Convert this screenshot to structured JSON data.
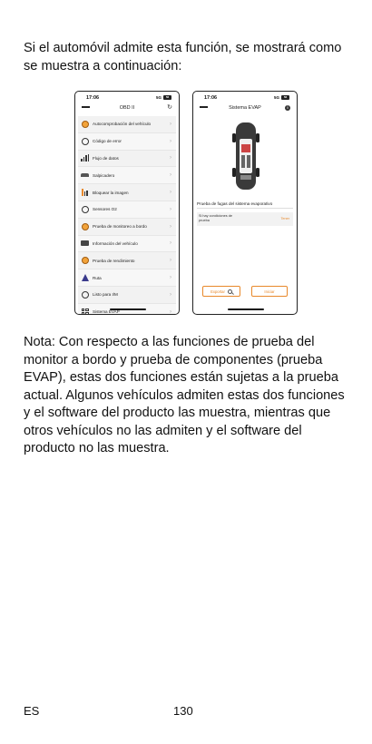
{
  "intro": "Si el automóvil admite esta función, se mostrará como se muestra a continuación:",
  "phone1": {
    "time": "17:06",
    "network": "5G",
    "battery": "56",
    "title": "OBD II",
    "menu": [
      {
        "label": "Autocomprobación del vehículo",
        "icon": "self-check-icon"
      },
      {
        "label": "Código de error",
        "icon": "error-code-icon"
      },
      {
        "label": "Flujo de datos",
        "icon": "data-stream-icon"
      },
      {
        "label": "Salpicadero",
        "icon": "dashboard-icon"
      },
      {
        "label": "Bloquear la imagen",
        "icon": "freeze-frame-icon"
      },
      {
        "label": "Sensores O2",
        "icon": "o2-sensor-icon"
      },
      {
        "label": "Prueba de monitoreo a bordo",
        "icon": "onboard-monitor-icon"
      },
      {
        "label": "Información del vehículo",
        "icon": "vehicle-info-icon"
      },
      {
        "label": "Prueba de rendimiento",
        "icon": "performance-icon"
      },
      {
        "label": "Ruta",
        "icon": "route-icon"
      },
      {
        "label": "Listo para I/M",
        "icon": "im-readiness-icon"
      },
      {
        "label": "Sistema EVAP",
        "icon": "evap-icon"
      }
    ]
  },
  "phone2": {
    "time": "17:06",
    "network": "5G",
    "battery": "56",
    "title": "Sistema EVAP",
    "section_title": "Prueba de fugas del sistema evaporativo",
    "row_label": "Si hay condiciones de prueba",
    "row_value": "Tener",
    "export_label": "Exportar",
    "start_label": "Iniciar"
  },
  "note": "Nota: Con respecto a las funciones de prueba del monitor a bordo y prueba de componentes (prueba EVAP), estas dos funciones están sujetas a la prueba actual. Algunos vehículos admiten estas dos funciones y el software del producto las muestra, mientras que otros vehículos no las admiten y el software del producto no las muestra.",
  "footer": {
    "lang": "ES",
    "page": "130"
  },
  "colors": {
    "accent": "#e8892b"
  }
}
